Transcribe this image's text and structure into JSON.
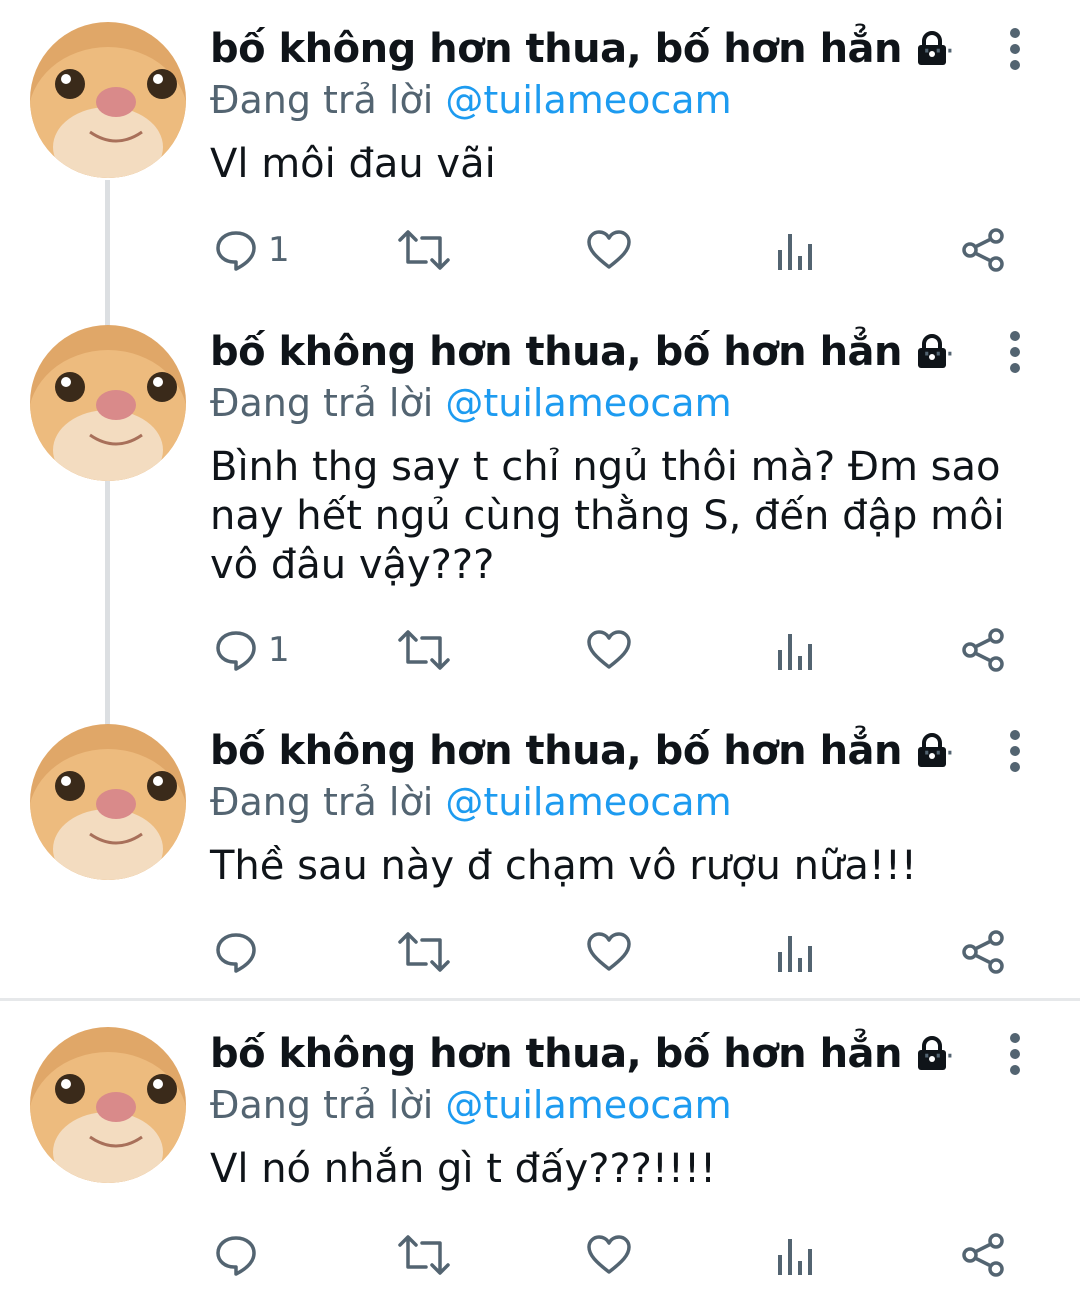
{
  "tweets": [
    {
      "name": "bố không hơn thua, bố hơn hẳn",
      "replying_prefix": "Đang trả lời",
      "mention": "@tuilameocam",
      "text": "Vl môi đau vãi",
      "more": "···",
      "reply_count": "1"
    },
    {
      "name": "bố không hơn thua, bố hơn hẳn",
      "replying_prefix": "Đang trả lời",
      "mention": "@tuilameocam",
      "text_lines": [
        "Bình thg say t chỉ ngủ thôi mà? Đm sao",
        "nay hết ngủ cùng thằng S, đến đập môi",
        "vô đâu vậy???"
      ],
      "more": "···",
      "reply_count": "1"
    },
    {
      "name": "bố không hơn thua, bố hơn hẳn",
      "replying_prefix": "Đang trả lời",
      "mention": "@tuilameocam",
      "text": "Thề sau này đ chạm vô rượu nữa!!!",
      "more": "···",
      "reply_count": ""
    },
    {
      "name": "bố không hơn thua, bố hơn hẳn",
      "replying_prefix": "Đang trả lời",
      "mention": "@tuilameocam",
      "text": "Vl nó nhắn gì t đấy???!!!!",
      "more": "···",
      "reply_count": ""
    }
  ],
  "icons": {
    "reply": "reply-icon",
    "retweet": "retweet-icon",
    "like": "heart-icon",
    "views": "views-icon",
    "share": "share-icon",
    "lock": "lock-icon",
    "more": "kebab-icon"
  },
  "colors": {
    "text": "#0f1419",
    "secondary": "#536471",
    "mention": "#1d9bf0",
    "thread_line": "#dcdfe2",
    "divider": "#e6e8ea"
  }
}
